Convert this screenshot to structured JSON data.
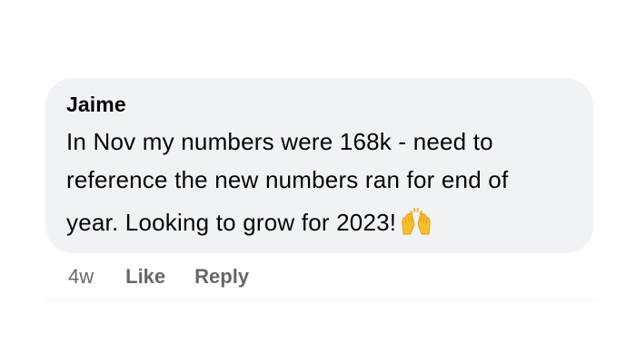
{
  "comment": {
    "author": "Jaime",
    "text_lines": [
      "In Nov my numbers were 168k - need to",
      "reference the new numbers ran for end of",
      "year. Looking to grow for 2023!"
    ],
    "emoji": "raising-hands-emoji"
  },
  "actions": {
    "timestamp": "4w",
    "like_label": "Like",
    "reply_label": "Reply"
  },
  "colors": {
    "bubble_bg": "#f0f2f5",
    "text_primary": "#050505",
    "text_secondary": "#65676b",
    "emoji_yellow": "#f7c02b"
  }
}
